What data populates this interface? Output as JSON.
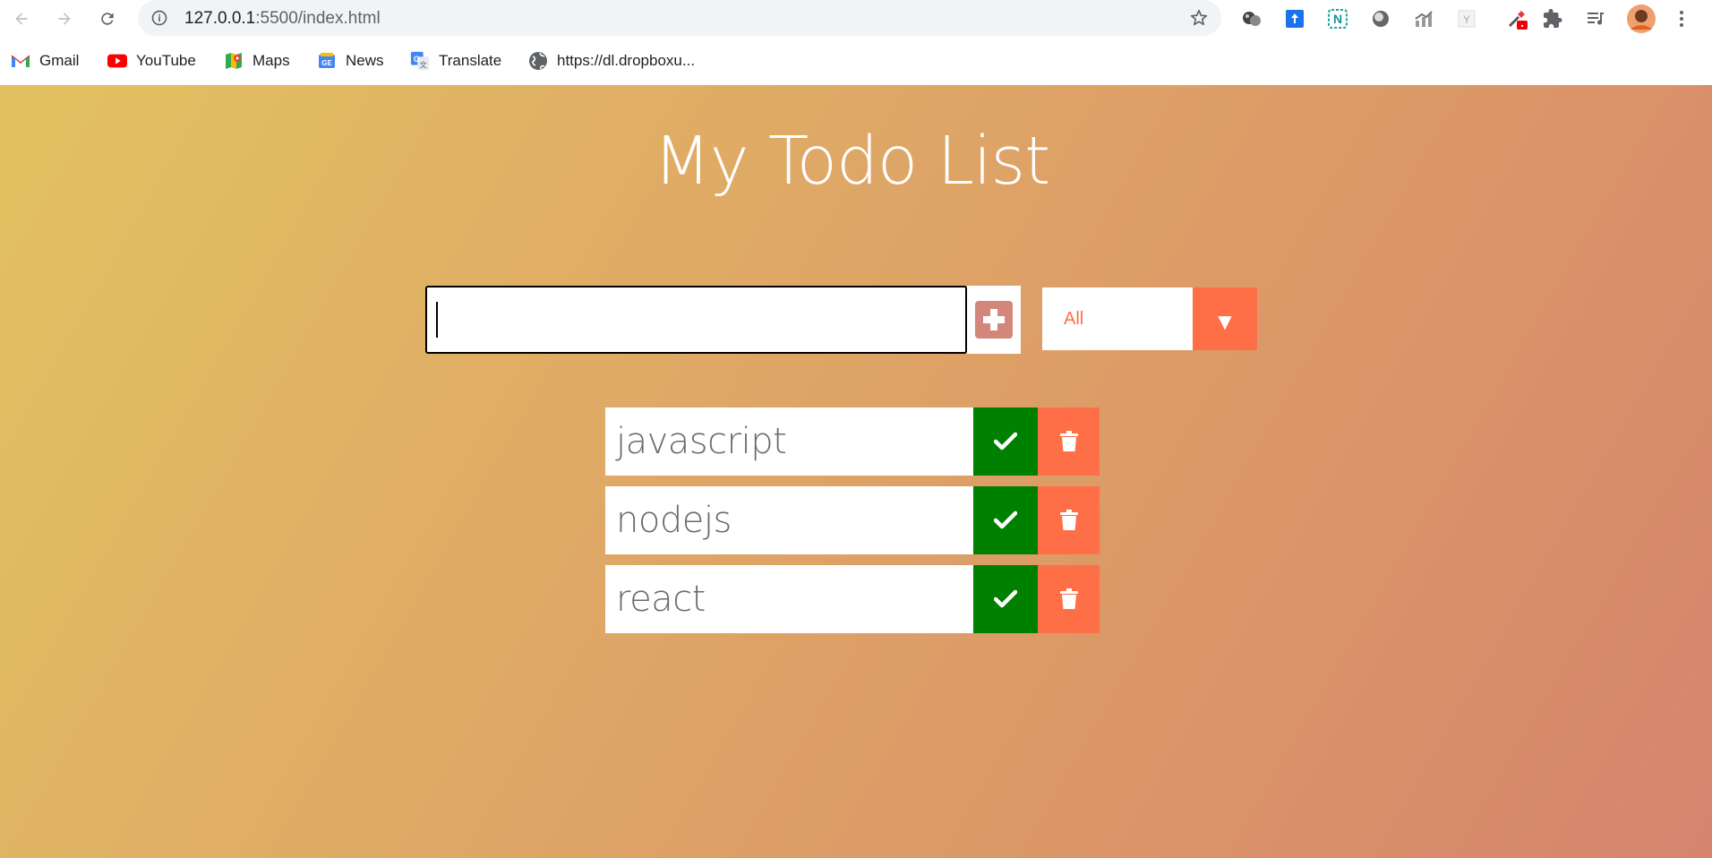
{
  "browser": {
    "url_host": "127.0.0.1",
    "url_rest": ":5500/index.html",
    "bookmarks": [
      {
        "label": "Gmail",
        "icon": "gmail-icon"
      },
      {
        "label": "YouTube",
        "icon": "youtube-icon"
      },
      {
        "label": "Maps",
        "icon": "maps-icon"
      },
      {
        "label": "News",
        "icon": "news-icon"
      },
      {
        "label": "Translate",
        "icon": "translate-icon"
      },
      {
        "label": "https://dl.dropboxu...",
        "icon": "globe-icon"
      }
    ]
  },
  "page": {
    "title": "My Todo List",
    "input_value": "",
    "filter": {
      "selected": "All"
    },
    "todos": [
      {
        "text": "javascript"
      },
      {
        "text": "nodejs"
      },
      {
        "text": "react"
      }
    ]
  },
  "colors": {
    "accent": "#ff6f47",
    "complete": "#008000",
    "add_button": "#d2877a",
    "gradient_start": "#e2c260",
    "gradient_end": "#d6846e"
  }
}
